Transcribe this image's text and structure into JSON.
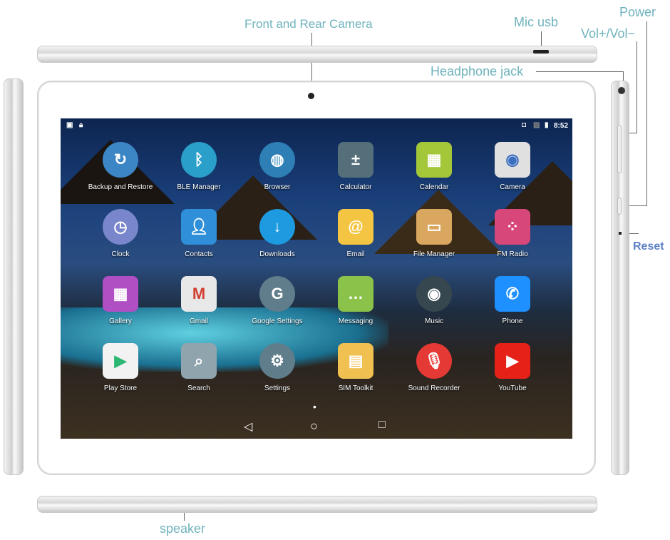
{
  "annotations": {
    "front_rear_camera": "Front and Rear Camera",
    "mic_usb": "Mic usb",
    "power": "Power",
    "volume": "Vol+/Vol−",
    "headphone_jack": "Headphone jack",
    "reset": "Reset",
    "speaker": "speaker"
  },
  "status_bar": {
    "time": "8:52",
    "left_icons": [
      "image-icon",
      "lock-icon"
    ],
    "right_icons": [
      "vibrate-icon",
      "no-sim-icon",
      "battery-icon"
    ]
  },
  "apps": [
    {
      "label": "Backup and Restore",
      "icon": "backup-icon",
      "color": "#3d86c6"
    },
    {
      "label": "BLE Manager",
      "icon": "bluetooth-icon",
      "color": "#2a9fc9"
    },
    {
      "label": "Browser",
      "icon": "globe-icon",
      "color": "#2d7fb5"
    },
    {
      "label": "Calculator",
      "icon": "calculator-icon",
      "color": "#546e7a"
    },
    {
      "label": "Calendar",
      "icon": "calendar-icon",
      "color": "#a4c639"
    },
    {
      "label": "Camera",
      "icon": "camera-icon",
      "color": "#e0e0e0"
    },
    {
      "label": "Clock",
      "icon": "clock-icon",
      "color": "#7986cb"
    },
    {
      "label": "Contacts",
      "icon": "contacts-icon",
      "color": "#2f8fd8"
    },
    {
      "label": "Downloads",
      "icon": "download-icon",
      "color": "#1e9be0"
    },
    {
      "label": "Email",
      "icon": "email-icon",
      "color": "#f4c542"
    },
    {
      "label": "File Manager",
      "icon": "folder-icon",
      "color": "#d9a760"
    },
    {
      "label": "FM Radio",
      "icon": "radio-icon",
      "color": "#d8477a"
    },
    {
      "label": "Gallery",
      "icon": "gallery-icon",
      "color": "#b04fc4"
    },
    {
      "label": "Gmail",
      "icon": "gmail-icon",
      "color": "#e8e8e8"
    },
    {
      "label": "Google Settings",
      "icon": "google-settings-icon",
      "color": "#607d8b"
    },
    {
      "label": "Messaging",
      "icon": "messaging-icon",
      "color": "#8bc34a"
    },
    {
      "label": "Music",
      "icon": "music-icon",
      "color": "#37474f"
    },
    {
      "label": "Phone",
      "icon": "phone-icon",
      "color": "#1e90ff"
    },
    {
      "label": "Play Store",
      "icon": "play-store-icon",
      "color": "#f2f2f2"
    },
    {
      "label": "Search",
      "icon": "search-icon",
      "color": "#90a4ae"
    },
    {
      "label": "Settings",
      "icon": "settings-icon",
      "color": "#607d8b"
    },
    {
      "label": "SIM Toolkit",
      "icon": "sim-icon",
      "color": "#f0c050"
    },
    {
      "label": "Sound Recorder",
      "icon": "microphone-icon",
      "color": "#e53935"
    },
    {
      "label": "YouTube",
      "icon": "youtube-icon",
      "color": "#e62117"
    }
  ],
  "navigation": {
    "back": "◁",
    "home": "○",
    "recents": "□",
    "page_indicator": "•"
  }
}
